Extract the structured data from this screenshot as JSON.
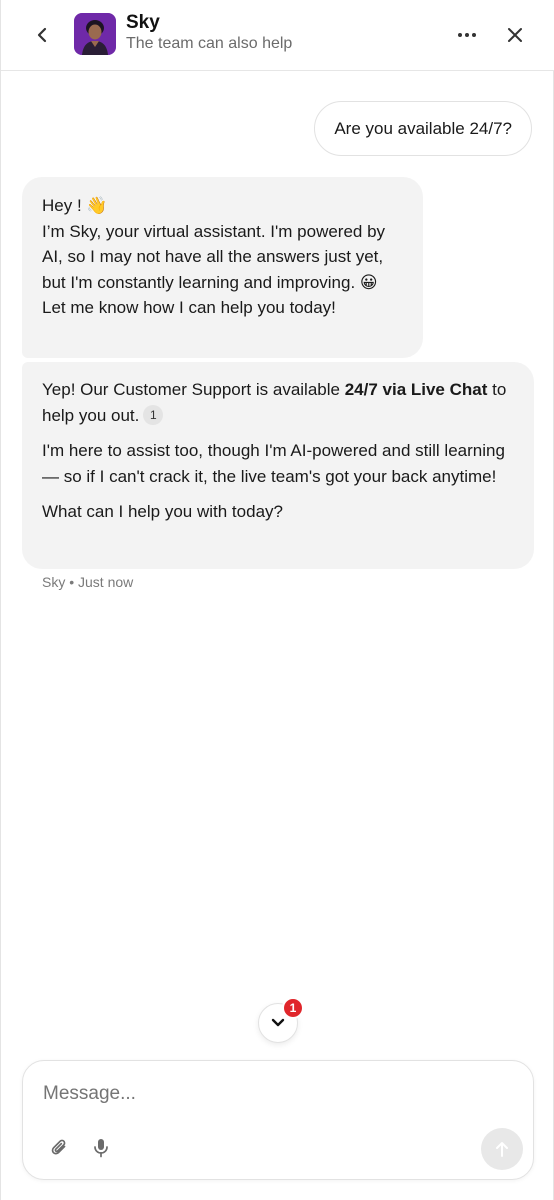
{
  "header": {
    "title": "Sky",
    "subtitle": "The team can also help"
  },
  "icons": {
    "back": "chevron-left-icon",
    "more": "more-horizontal-icon",
    "close": "close-icon",
    "scroll_down": "chevron-down-icon",
    "attach": "paperclip-icon",
    "mic": "microphone-icon",
    "send": "arrow-up-icon"
  },
  "colors": {
    "badge": "#e0262b",
    "bot_bubble": "#f3f3f3",
    "avatar_bg": "#7b2fb5"
  },
  "messages": {
    "user_1": "Are you available 24/7?",
    "bot_1": {
      "line1": "Hey ! 👋",
      "line2": "I’m Sky, your virtual assistant. I'm powered by AI, so I may not have all the answers just yet, but I'm constantly learning and improving. 😀 Let me know how I can help you today!"
    },
    "bot_2": {
      "p1_before": "Yep! Our Customer Support is available ",
      "p1_bold": "24/7 via Live Chat",
      "p1_after": " to help you out.",
      "citation": "1",
      "p2": "I'm here to assist too, though I'm AI-powered and still learning — so if I can't crack it, the live team's got your back anytime!",
      "p3": "What can I help you with today?"
    },
    "meta": "Sky • Just now"
  },
  "scroll": {
    "badge_count": "1"
  },
  "composer": {
    "placeholder": "Message..."
  }
}
